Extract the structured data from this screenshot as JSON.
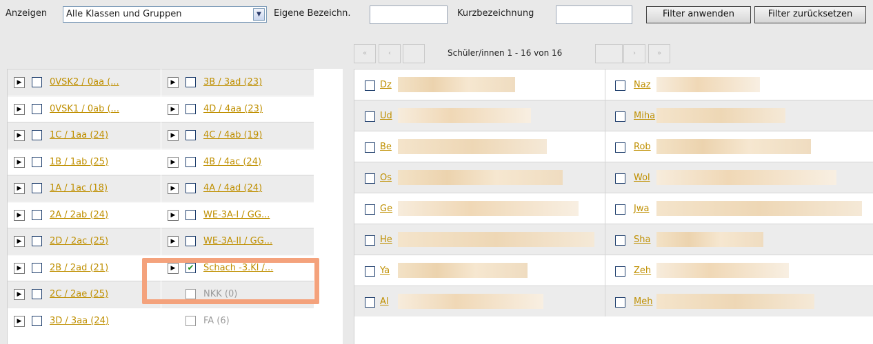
{
  "filter": {
    "show_label": "Anzeigen",
    "show_selected": "Alle Klassen und Gruppen",
    "custom_name_label": "Eigene Bezeichn.",
    "short_name_label": "Kurzbezeichnung",
    "apply_label": "Filter anwenden",
    "reset_label": "Filter zurücksetzen"
  },
  "pager": {
    "first": "«",
    "prev": "‹",
    "text": "Schüler/innen 1 - 16 von 16",
    "next": "›",
    "last": "»"
  },
  "classes": {
    "col1": [
      {
        "label": "0VSK2 / 0aa (...",
        "checked": false
      },
      {
        "label": "0VSK1 / 0ab (...",
        "checked": false
      },
      {
        "label": "1C / 1aa (24)",
        "checked": false
      },
      {
        "label": "1B / 1ab (25)",
        "checked": false
      },
      {
        "label": "1A / 1ac (18)",
        "checked": false
      },
      {
        "label": "2A / 2ab (24)",
        "checked": false
      },
      {
        "label": "2D / 2ac (25)",
        "checked": false
      },
      {
        "label": "2B / 2ad (21)",
        "checked": false
      },
      {
        "label": "2C / 2ae (25)",
        "checked": false
      },
      {
        "label": "3D / 3aa (24)",
        "checked": false
      }
    ],
    "col2": [
      {
        "label": "3B / 3ad (23)",
        "checked": false,
        "disabled": false
      },
      {
        "label": "4D / 4aa (23)",
        "checked": false,
        "disabled": false
      },
      {
        "label": "4C / 4ab (19)",
        "checked": false,
        "disabled": false
      },
      {
        "label": "4B / 4ac (24)",
        "checked": false,
        "disabled": false
      },
      {
        "label": "4A / 4ad (24)",
        "checked": false,
        "disabled": false
      },
      {
        "label": "WE-3A-I / GG...",
        "checked": false,
        "disabled": false
      },
      {
        "label": "WE-3A-II / GG...",
        "checked": false,
        "disabled": false
      },
      {
        "label": "Schach -3.Kl /...",
        "checked": true,
        "disabled": false
      },
      {
        "label": "NKK (0)",
        "checked": false,
        "disabled": true
      },
      {
        "label": "FA (6)",
        "checked": false,
        "disabled": true
      }
    ]
  },
  "students": {
    "col1": [
      "Dz",
      "Ud",
      "Be",
      "Os",
      "Ge",
      "He",
      "Ya",
      "Al"
    ],
    "col2": [
      "Naz",
      "Miha",
      "Rob",
      "Wol",
      "Jwa",
      "Sha",
      "Zeh",
      "Meh"
    ]
  },
  "icons": {
    "expand": "▶",
    "check": "✔",
    "dropdown": "▼"
  }
}
